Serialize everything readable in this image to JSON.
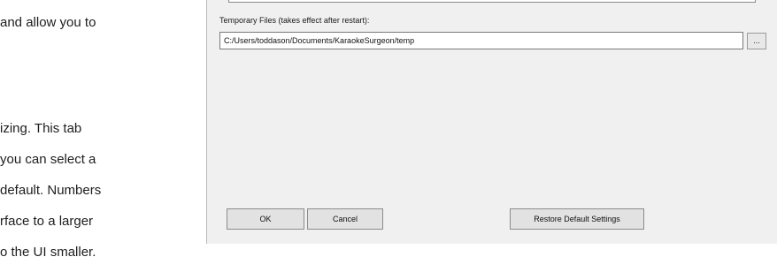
{
  "document": {
    "lines": [
      "and allow you to",
      "izing.  This tab",
      "you can select a",
      "default. Numbers",
      "rface to a larger",
      "o the UI smaller."
    ]
  },
  "dialog": {
    "temp_files_label": "Temporary Files (takes effect after restart):",
    "temp_files_path": "C:/Users/toddason/Documents/KaraokeSurgeon/temp",
    "browse_label": "...",
    "buttons": {
      "ok": "OK",
      "cancel": "Cancel",
      "restore_defaults": "Restore Default Settings"
    }
  }
}
